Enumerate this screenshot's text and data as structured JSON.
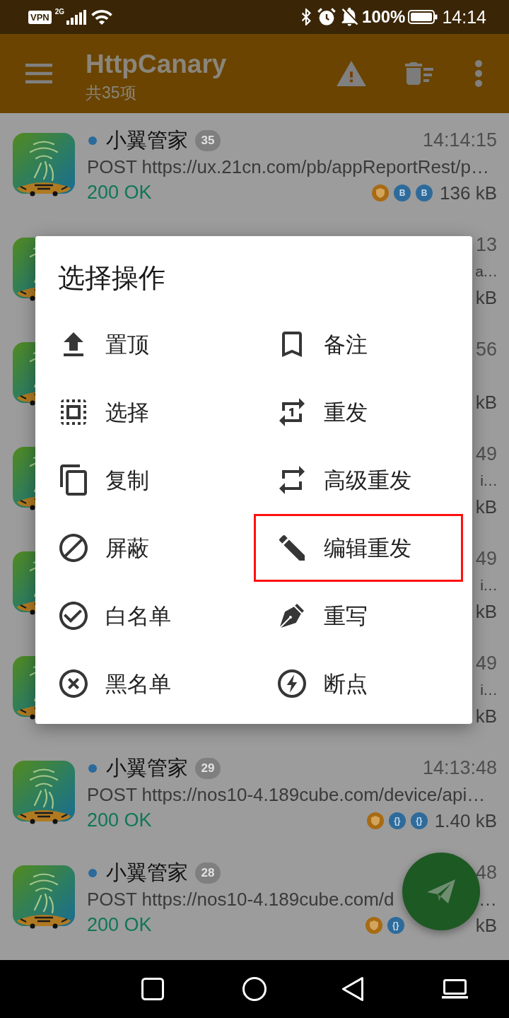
{
  "status_bar": {
    "vpn": "VPN",
    "network": "2G",
    "battery": "100%",
    "time": "14:14"
  },
  "app_bar": {
    "title": "HttpCanary",
    "subtitle": "共35项"
  },
  "requests": [
    {
      "kind": "full",
      "name": "小翼管家",
      "badge": "35",
      "time": "14:14:15",
      "url": "POST https://ux.21cn.com/pb/appReportRest/p…",
      "status": "200 OK",
      "tags": [
        {
          "kind": "ssl"
        },
        {
          "kind": "body",
          "label": "B"
        },
        {
          "kind": "body",
          "label": "B"
        }
      ],
      "size": "136 kB",
      "covered": false
    },
    {
      "kind": "edge",
      "time": "13",
      "url": "a…",
      "size": "kB"
    },
    {
      "kind": "edge",
      "time": "56",
      "size": "kB"
    },
    {
      "kind": "edge",
      "time": "49",
      "url": "i…",
      "size": "kB"
    },
    {
      "kind": "edge",
      "time": "49",
      "url": "i…",
      "size": "kB"
    },
    {
      "kind": "edge",
      "time": "49",
      "url": "i…",
      "size": "kB"
    },
    {
      "kind": "full",
      "name": "小翼管家",
      "badge": "29",
      "time": "14:13:48",
      "url": "POST https://nos10-4.189cube.com/device/api…",
      "status": "200 OK",
      "tags": [
        {
          "kind": "ssl"
        },
        {
          "kind": "body",
          "label": "{}"
        },
        {
          "kind": "body",
          "label": "{}"
        }
      ],
      "size": "1.40 kB",
      "covered": false
    },
    {
      "kind": "full",
      "name": "小翼管家",
      "badge": "28",
      "time": "48",
      "url": "POST https://nos10-4.189cube.com/d",
      "url_tail": "…",
      "status": "200 OK",
      "tags": [
        {
          "kind": "ssl"
        },
        {
          "kind": "body",
          "label": "{}"
        }
      ],
      "size": "kB",
      "covered": true
    }
  ],
  "dialog": {
    "title": "选择操作",
    "actions": [
      {
        "kind": "top",
        "label": "置顶",
        "highlighted": false
      },
      {
        "kind": "note",
        "label": "备注",
        "highlighted": false
      },
      {
        "kind": "select",
        "label": "选择",
        "highlighted": false
      },
      {
        "kind": "resend",
        "label": "重发",
        "highlighted": false
      },
      {
        "kind": "copy",
        "label": "复制",
        "highlighted": false
      },
      {
        "kind": "advanced",
        "label": "高级重发",
        "highlighted": false
      },
      {
        "kind": "block",
        "label": "屏蔽",
        "highlighted": false
      },
      {
        "kind": "edit",
        "label": "编辑重发",
        "highlighted": true
      },
      {
        "kind": "allow",
        "label": "白名单",
        "highlighted": false
      },
      {
        "kind": "rewrite",
        "label": "重写",
        "highlighted": false
      },
      {
        "kind": "deny",
        "label": "黑名单",
        "highlighted": false
      },
      {
        "kind": "breakpoint",
        "label": "断点",
        "highlighted": false
      }
    ]
  }
}
